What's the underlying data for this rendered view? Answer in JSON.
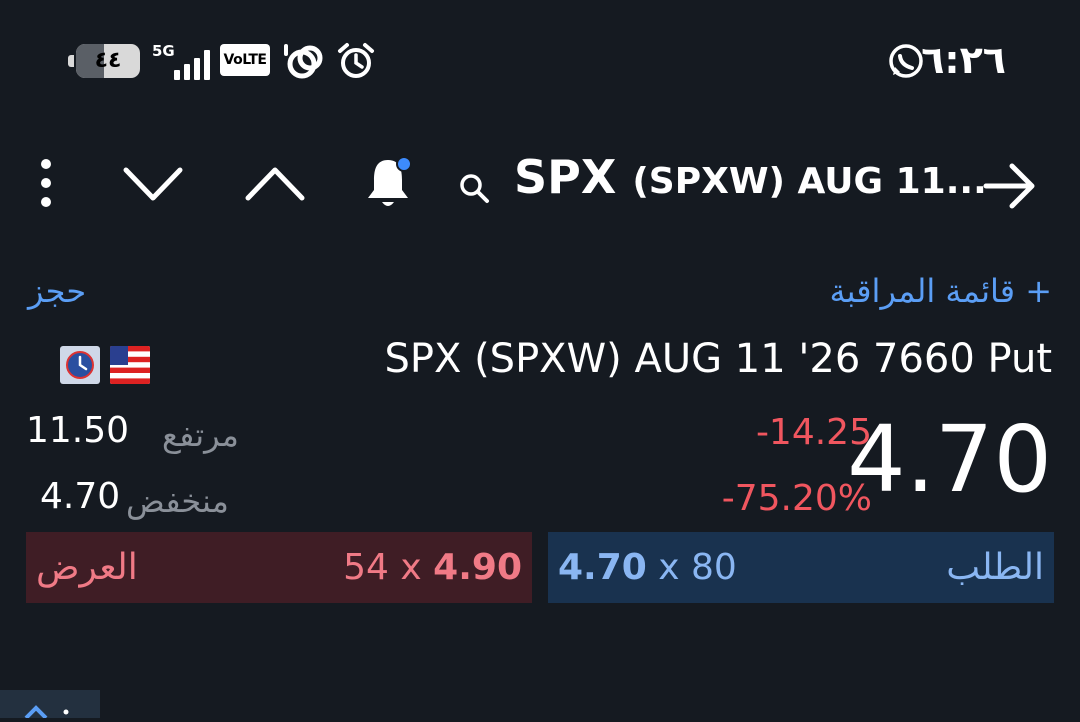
{
  "status_bar": {
    "battery": "٤٤",
    "battery_level": 0.44,
    "network": "5G",
    "volte": "VoLTE",
    "time": "٦:٢٦",
    "icons": [
      "battery-icon",
      "signal-icon",
      "volte-icon",
      "hotspot-icon",
      "alarm-icon",
      "whatsapp-icon"
    ]
  },
  "toolbar": {
    "icons": [
      "more-vert-icon",
      "chevron-down-icon",
      "chevron-up-icon",
      "bell-icon",
      "search-icon",
      "arrow-forward-icon"
    ],
    "symbol": "SPX",
    "symbol_detail": "(SPXW) AUG 11..."
  },
  "actions": {
    "watchlist": "+ قائمة المراقبة",
    "book": "حجز"
  },
  "instrument": {
    "full_name": "SPX (SPXW) AUG 11 '26 7660 Put",
    "badges": [
      "us-flag-icon",
      "clock-icon"
    ]
  },
  "quote": {
    "last": "4.70",
    "change": "-14.25",
    "change_pct": "-75.20%",
    "high_label": "مرتفع",
    "high_value": "11.50",
    "low_label": "منخفض",
    "low_value": "4.70"
  },
  "bid": {
    "label": "الطلب",
    "price": "4.70",
    "size_text": "x 80"
  },
  "ask": {
    "label": "العرض",
    "size_text": "54 x",
    "price": "4.90"
  },
  "colors": {
    "background": "#151a21",
    "accent": "#5b9ef5",
    "negative": "#f0565f",
    "bid_bg": "#19324f",
    "ask_bg": "#3f1d25",
    "bid_text": "#8ab6f2",
    "ask_text": "#f07a86"
  }
}
